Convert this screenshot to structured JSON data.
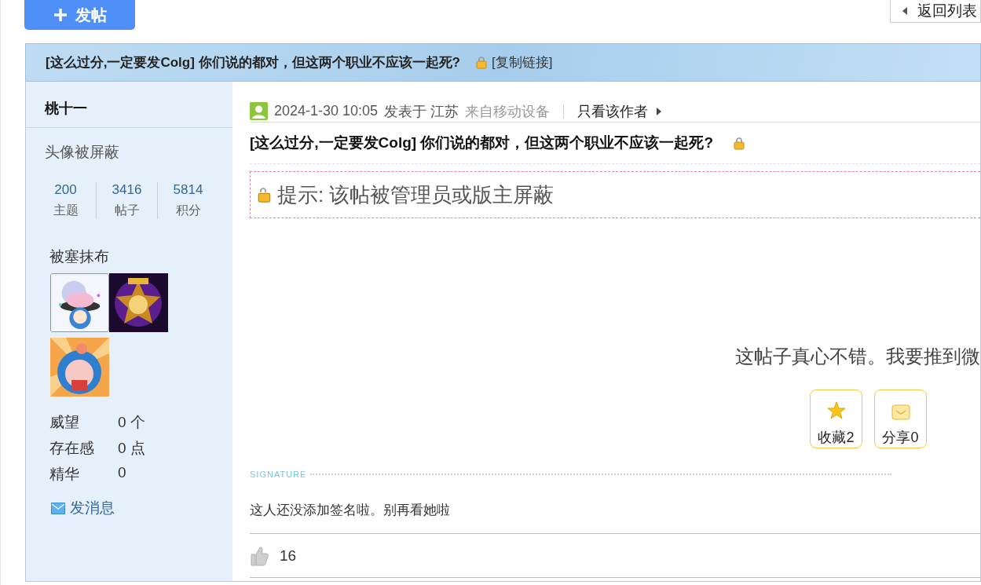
{
  "toolbar": {
    "post_button": "发帖",
    "back_button": "返回列表"
  },
  "thread": {
    "title": "[这么过分,一定要发Colg] 你们说的都对，但这两个职业不应该一起死?",
    "locked": true,
    "copy_link": "[复制链接]"
  },
  "author": {
    "name": "桃十一",
    "avatar_text": "头像被屏蔽",
    "stats": [
      {
        "value": "200",
        "label": "主题"
      },
      {
        "value": "3416",
        "label": "帖子"
      },
      {
        "value": "5814",
        "label": "积分"
      }
    ],
    "group": "被塞抹布",
    "medals": [
      {
        "kind": "picture",
        "framed": true
      },
      {
        "kind": "picture",
        "framed": false
      },
      {
        "kind": "picture",
        "framed": false
      }
    ],
    "fields": [
      {
        "label": "威望",
        "value": "0 个"
      },
      {
        "label": "存在感",
        "value": "0 点"
      },
      {
        "label": "精华",
        "value": "0"
      }
    ],
    "message_link": "发消息"
  },
  "post": {
    "date": "2024-1-30 10:05",
    "posted_in": "发表于 江苏",
    "source": "来自移动设备",
    "only_author": "只看该作者",
    "title": "[这么过分,一定要发Colg] 你们说的都对，但这两个职业不应该一起死?",
    "locked": true,
    "notice": "提示: 该帖被管理员或版主屏蔽",
    "promo": "这帖子真心不错。我要推到微",
    "actions": [
      {
        "kind": "favorite",
        "label": "收藏2"
      },
      {
        "kind": "share",
        "label": "分享0"
      }
    ],
    "signature_label": "SIGNATURE",
    "signature": "这人还没添加签名啦。别再看她啦",
    "likes": "16"
  }
}
